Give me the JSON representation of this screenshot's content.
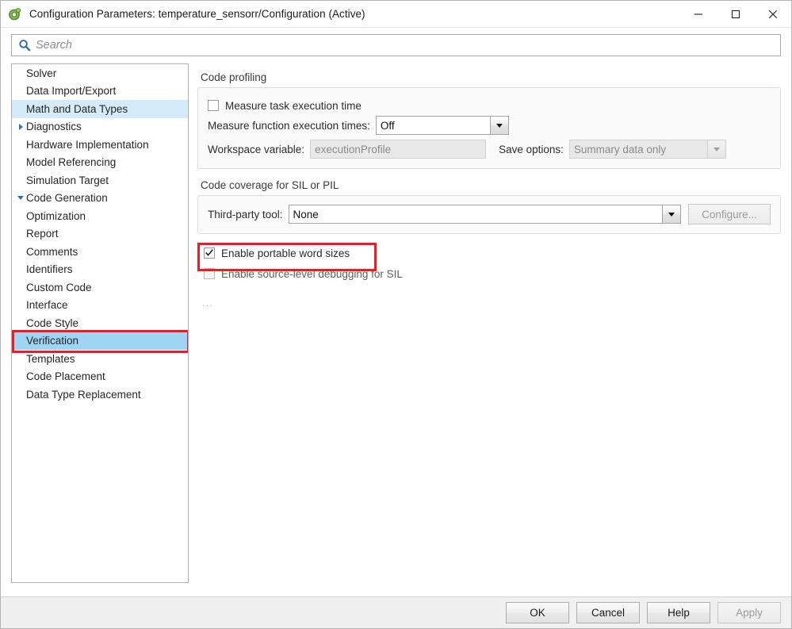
{
  "window": {
    "title": "Configuration Parameters: temperature_sensorr/Configuration (Active)",
    "app_icon": "simulink-config-icon",
    "minimize_label": "minimize-icon",
    "maximize_label": "maximize-icon",
    "close_label": "close-icon"
  },
  "search": {
    "placeholder": "Search",
    "value": "",
    "icon": "search-icon"
  },
  "sidebar": {
    "items": [
      {
        "label": "Solver",
        "level": 0,
        "arrow": "none",
        "state": "normal"
      },
      {
        "label": "Data Import/Export",
        "level": 0,
        "arrow": "none",
        "state": "normal"
      },
      {
        "label": "Math and Data Types",
        "level": 0,
        "arrow": "none",
        "state": "soft-selected"
      },
      {
        "label": "Diagnostics",
        "level": 0,
        "arrow": "collapsed",
        "state": "normal"
      },
      {
        "label": "Hardware Implementation",
        "level": 0,
        "arrow": "none",
        "state": "normal"
      },
      {
        "label": "Model Referencing",
        "level": 0,
        "arrow": "none",
        "state": "normal"
      },
      {
        "label": "Simulation Target",
        "level": 0,
        "arrow": "none",
        "state": "normal"
      },
      {
        "label": "Code Generation",
        "level": 0,
        "arrow": "expanded",
        "state": "normal"
      },
      {
        "label": "Optimization",
        "level": 1,
        "arrow": "none",
        "state": "normal"
      },
      {
        "label": "Report",
        "level": 1,
        "arrow": "none",
        "state": "normal"
      },
      {
        "label": "Comments",
        "level": 1,
        "arrow": "none",
        "state": "normal"
      },
      {
        "label": "Identifiers",
        "level": 1,
        "arrow": "none",
        "state": "normal"
      },
      {
        "label": "Custom Code",
        "level": 1,
        "arrow": "none",
        "state": "normal"
      },
      {
        "label": "Interface",
        "level": 1,
        "arrow": "none",
        "state": "normal"
      },
      {
        "label": "Code Style",
        "level": 1,
        "arrow": "none",
        "state": "normal"
      },
      {
        "label": "Verification",
        "level": 1,
        "arrow": "none",
        "state": "selected"
      },
      {
        "label": "Templates",
        "level": 1,
        "arrow": "none",
        "state": "normal"
      },
      {
        "label": "Code Placement",
        "level": 1,
        "arrow": "none",
        "state": "normal"
      },
      {
        "label": "Data Type Replacement",
        "level": 1,
        "arrow": "none",
        "state": "normal"
      }
    ]
  },
  "main": {
    "code_profiling": {
      "caption": "Code profiling",
      "measure_task_execution_time": {
        "label": "Measure task execution time",
        "checked": false,
        "enabled": true
      },
      "measure_function_execution_times": {
        "label": "Measure function execution times:",
        "value": "Off",
        "enabled": true
      },
      "workspace_variable": {
        "label": "Workspace variable:",
        "value": "executionProfile",
        "enabled": false
      },
      "save_options": {
        "label": "Save options:",
        "value": "Summary data only",
        "enabled": false
      }
    },
    "code_coverage": {
      "caption": "Code coverage for SIL or PIL",
      "third_party_tool": {
        "label": "Third-party tool:",
        "value": "None",
        "enabled": true
      },
      "configure_button": {
        "label": "Configure...",
        "enabled": false
      }
    },
    "enable_portable_word_sizes": {
      "label": "Enable portable word sizes",
      "checked": true,
      "enabled": true
    },
    "enable_source_level_debugging": {
      "label": "Enable source-level debugging for SIL",
      "checked": false,
      "enabled": false
    },
    "overflow_note": "..."
  },
  "footer": {
    "ok_label": "OK",
    "cancel_label": "Cancel",
    "help_label": "Help",
    "apply_label": "Apply",
    "apply_enabled": false
  },
  "annotations": {
    "highlight_color": "#ec1c24",
    "boxes": [
      {
        "target": "sidebar-item-verification"
      },
      {
        "target": "enable-portable-word-sizes-checkbox"
      }
    ]
  },
  "colors": {
    "selected_tree_item": "#9ed5f5",
    "soft_selected_tree_item": "#d6ebfa",
    "annotation_red": "#ec1c24",
    "search_icon_blue": "#31699c",
    "tree_arrow_blue": "#2f6fae"
  }
}
